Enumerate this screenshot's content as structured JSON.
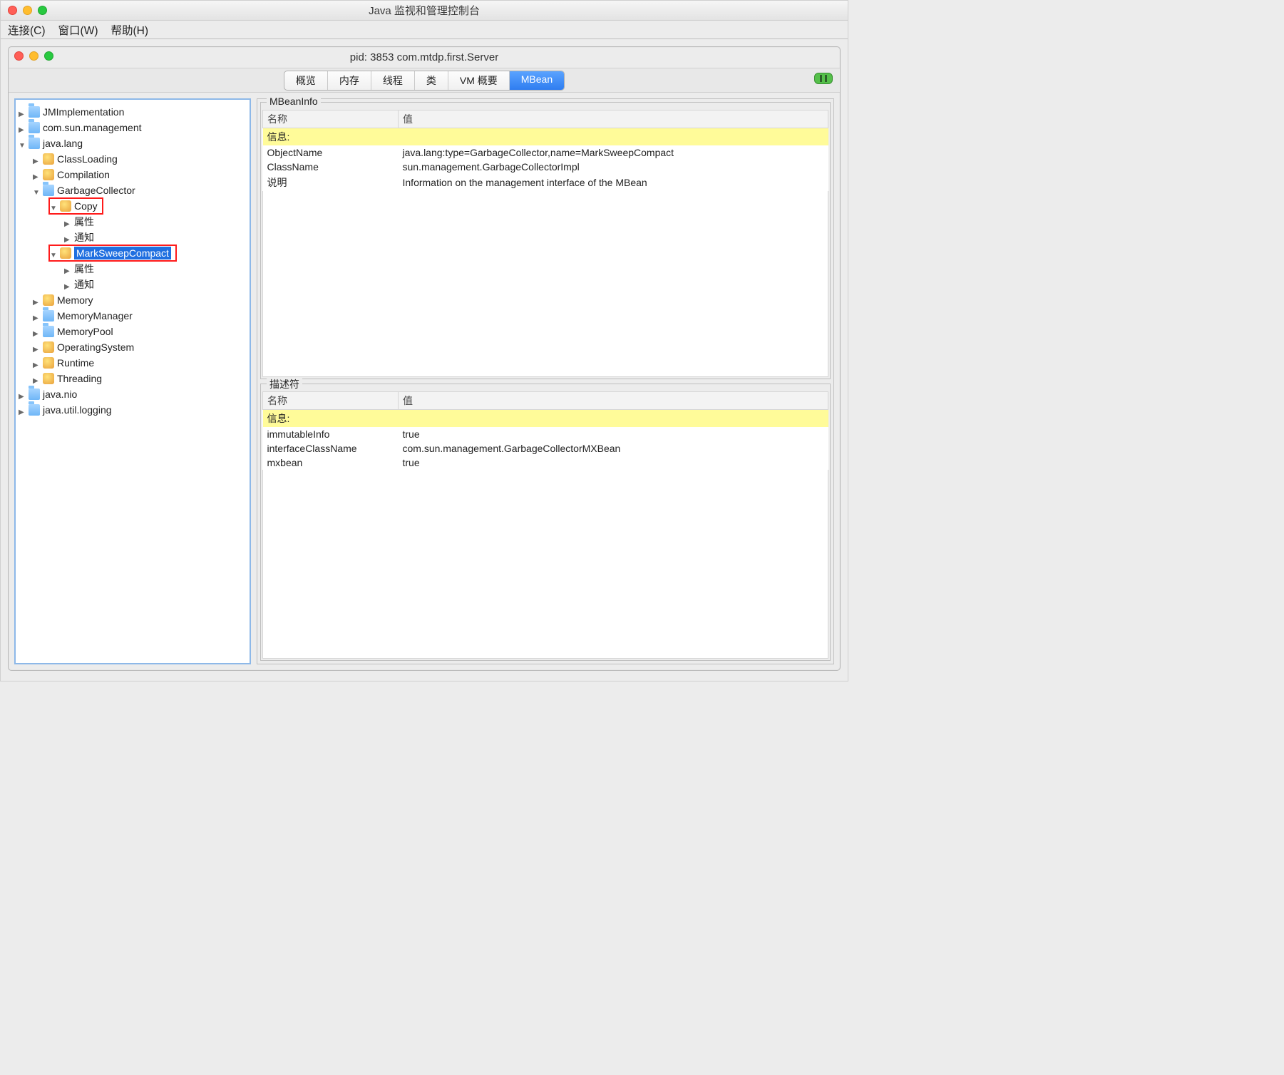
{
  "window": {
    "title": "Java 监视和管理控制台"
  },
  "menubar": {
    "connect": "连接(C)",
    "window": "窗口(W)",
    "help": "帮助(H)"
  },
  "internal": {
    "title": "pid: 3853 com.mtdp.first.Server"
  },
  "tabs": {
    "overview": "概览",
    "memory": "内存",
    "threads": "线程",
    "classes": "类",
    "vm": "VM 概要",
    "mbean": "MBean"
  },
  "tree": {
    "JMImplementation": "JMImplementation",
    "com_sun_management": "com.sun.management",
    "java_lang": "java.lang",
    "ClassLoading": "ClassLoading",
    "Compilation": "Compilation",
    "GarbageCollector": "GarbageCollector",
    "Copy": "Copy",
    "attr": "属性",
    "notif": "通知",
    "MarkSweepCompact": "MarkSweepCompact",
    "Memory": "Memory",
    "MemoryManager": "MemoryManager",
    "MemoryPool": "MemoryPool",
    "OperatingSystem": "OperatingSystem",
    "Runtime": "Runtime",
    "Threading": "Threading",
    "java_nio": "java.nio",
    "java_util_logging": "java.util.logging"
  },
  "info": {
    "title": "MBeanInfo",
    "col_name": "名称",
    "col_value": "值",
    "section": "信息:",
    "rows": [
      {
        "k": "ObjectName",
        "v": "java.lang:type=GarbageCollector,name=MarkSweepCompact"
      },
      {
        "k": "ClassName",
        "v": "sun.management.GarbageCollectorImpl"
      },
      {
        "k": "说明",
        "v": "Information on the management interface of the MBean"
      }
    ]
  },
  "desc": {
    "title": "描述符",
    "col_name": "名称",
    "col_value": "值",
    "section": "信息:",
    "rows": [
      {
        "k": "immutableInfo",
        "v": "true"
      },
      {
        "k": "interfaceClassName",
        "v": "com.sun.management.GarbageCollectorMXBean"
      },
      {
        "k": "mxbean",
        "v": "true"
      }
    ]
  }
}
